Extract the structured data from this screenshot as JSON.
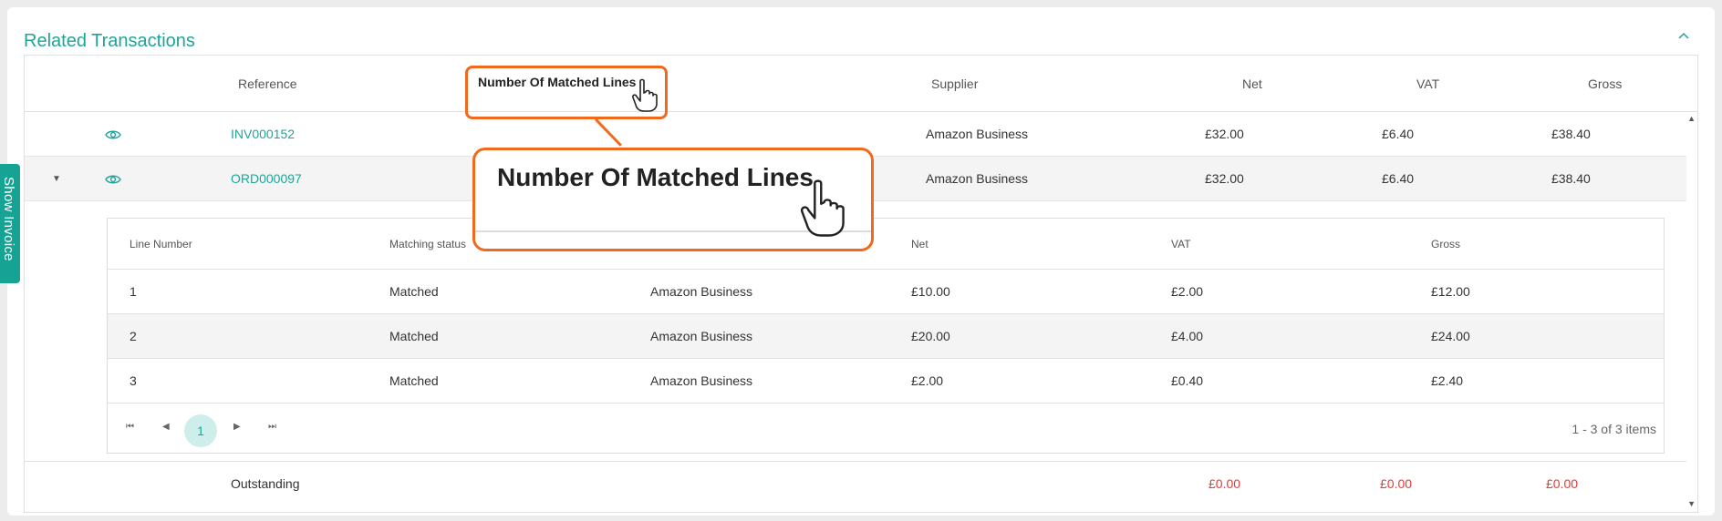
{
  "panel": {
    "title": "Related Transactions"
  },
  "side_tab": {
    "label": "Show Invoice"
  },
  "columns": {
    "reference": "Reference",
    "matched_lines": "Number Of Matched Lines",
    "supplier": "Supplier",
    "net": "Net",
    "vat": "VAT",
    "gross": "Gross"
  },
  "rows": [
    {
      "reference": "INV000152",
      "supplier": "Amazon Business",
      "net": "£32.00",
      "vat": "£6.40",
      "gross": "£38.40"
    },
    {
      "reference": "ORD000097",
      "supplier": "Amazon Business",
      "net": "£32.00",
      "vat": "£6.40",
      "gross": "£38.40"
    }
  ],
  "detail": {
    "columns": {
      "line_number": "Line Number",
      "matching_status": "Matching status",
      "net": "Net",
      "vat": "VAT",
      "gross": "Gross"
    },
    "rows": [
      {
        "line": "1",
        "status": "Matched",
        "supplier": "Amazon Business",
        "net": "£10.00",
        "vat": "£2.00",
        "gross": "£12.00"
      },
      {
        "line": "2",
        "status": "Matched",
        "supplier": "Amazon Business",
        "net": "£20.00",
        "vat": "£4.00",
        "gross": "£24.00"
      },
      {
        "line": "3",
        "status": "Matched",
        "supplier": "Amazon Business",
        "net": "£2.00",
        "vat": "£0.40",
        "gross": "£2.40"
      }
    ],
    "pager": {
      "page": "1",
      "info": "1 - 3 of 3 items"
    }
  },
  "outstanding": {
    "label": "Outstanding",
    "net": "£0.00",
    "vat": "£0.00",
    "gross": "£0.00"
  },
  "highlight": {
    "label": "Number Of Matched Lines"
  },
  "colors": {
    "accent": "#1fa598",
    "highlight": "#f06a1e",
    "negative": "#e53935"
  },
  "icons": [
    "chevron-up-icon",
    "eye-icon",
    "caret-down-icon",
    "first-page-icon",
    "prev-page-icon",
    "next-page-icon",
    "last-page-icon",
    "hand-cursor-icon",
    "scroll-up-icon",
    "scroll-down-icon"
  ]
}
